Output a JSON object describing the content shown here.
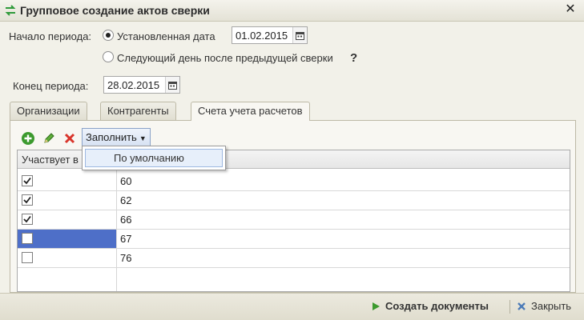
{
  "window": {
    "title": "Групповое создание актов сверки",
    "title_icon": "swap-arrows-icon",
    "close_icon": "close-icon"
  },
  "period": {
    "start_label": "Начало периода:",
    "option_fixed_label": "Установленная дата",
    "option_fixed_selected": true,
    "start_date": "01.02.2015",
    "option_next_day_label": "Следующий день после предыдущей сверки",
    "option_next_day_selected": false,
    "help": "?",
    "end_label": "Конец периода:",
    "end_date": "28.02.2015"
  },
  "tabs": [
    {
      "label": "Организации",
      "active": false
    },
    {
      "label": "Контрагенты",
      "active": false
    },
    {
      "label": "Счета учета расчетов",
      "active": true
    }
  ],
  "toolbar": {
    "add_icon": "add-icon",
    "edit_icon": "pencil-icon",
    "delete_icon": "delete-icon",
    "fill_label": "Заполнить",
    "fill_menu_item": "По умолчанию"
  },
  "table": {
    "columns": [
      "Участвует в",
      ""
    ],
    "rows": [
      {
        "checked": true,
        "account": "60",
        "selected": false
      },
      {
        "checked": true,
        "account": "62",
        "selected": false
      },
      {
        "checked": true,
        "account": "66",
        "selected": false
      },
      {
        "checked": false,
        "account": "67",
        "selected": true
      },
      {
        "checked": false,
        "account": "76",
        "selected": false
      }
    ]
  },
  "footer": {
    "create_label": "Создать документы",
    "create_icon": "play-icon",
    "close_label": "Закрыть",
    "close_icon": "close-x-icon"
  },
  "colors": {
    "selection": "#4e6fc8",
    "accent_green": "#3c9a2e",
    "delete_red": "#d9352b"
  }
}
